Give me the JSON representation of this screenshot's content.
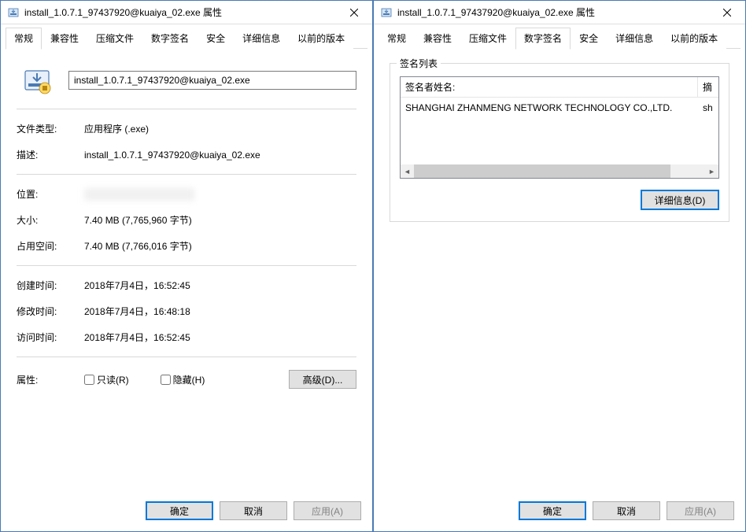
{
  "title_suffix": "属性",
  "filename": "install_1.0.7.1_97437920@kuaiya_02.exe",
  "tabs": {
    "general": "常规",
    "compat": "兼容性",
    "archive": "压缩文件",
    "sig": "数字签名",
    "security": "安全",
    "details": "详细信息",
    "prev": "以前的版本"
  },
  "general": {
    "fields": {
      "filetype_label": "文件类型:",
      "filetype_value": "应用程序 (.exe)",
      "desc_label": "描述:",
      "desc_value": "install_1.0.7.1_97437920@kuaiya_02.exe",
      "location_label": "位置:",
      "size_label": "大小:",
      "size_value": "7.40 MB (7,765,960 字节)",
      "disksize_label": "占用空间:",
      "disksize_value": "7.40 MB (7,766,016 字节)",
      "created_label": "创建时间:",
      "created_value": "2018年7月4日，16:52:45",
      "modified_label": "修改时间:",
      "modified_value": "2018年7月4日，16:48:18",
      "accessed_label": "访问时间:",
      "accessed_value": "2018年7月4日，16:52:45",
      "attrs_label": "属性:",
      "readonly_label": "只读(R)",
      "hidden_label": "隐藏(H)",
      "advanced_btn": "高级(D)..."
    }
  },
  "sig": {
    "group_title": "签名列表",
    "header_name": "签名者姓名:",
    "header_digest": "摘",
    "row_name": "SHANGHAI ZHANMENG NETWORK TECHNOLOGY CO.,LTD.",
    "row_digest": "sh",
    "details_btn": "详细信息(D)"
  },
  "buttons": {
    "ok": "确定",
    "cancel": "取消",
    "apply": "应用(A)"
  }
}
